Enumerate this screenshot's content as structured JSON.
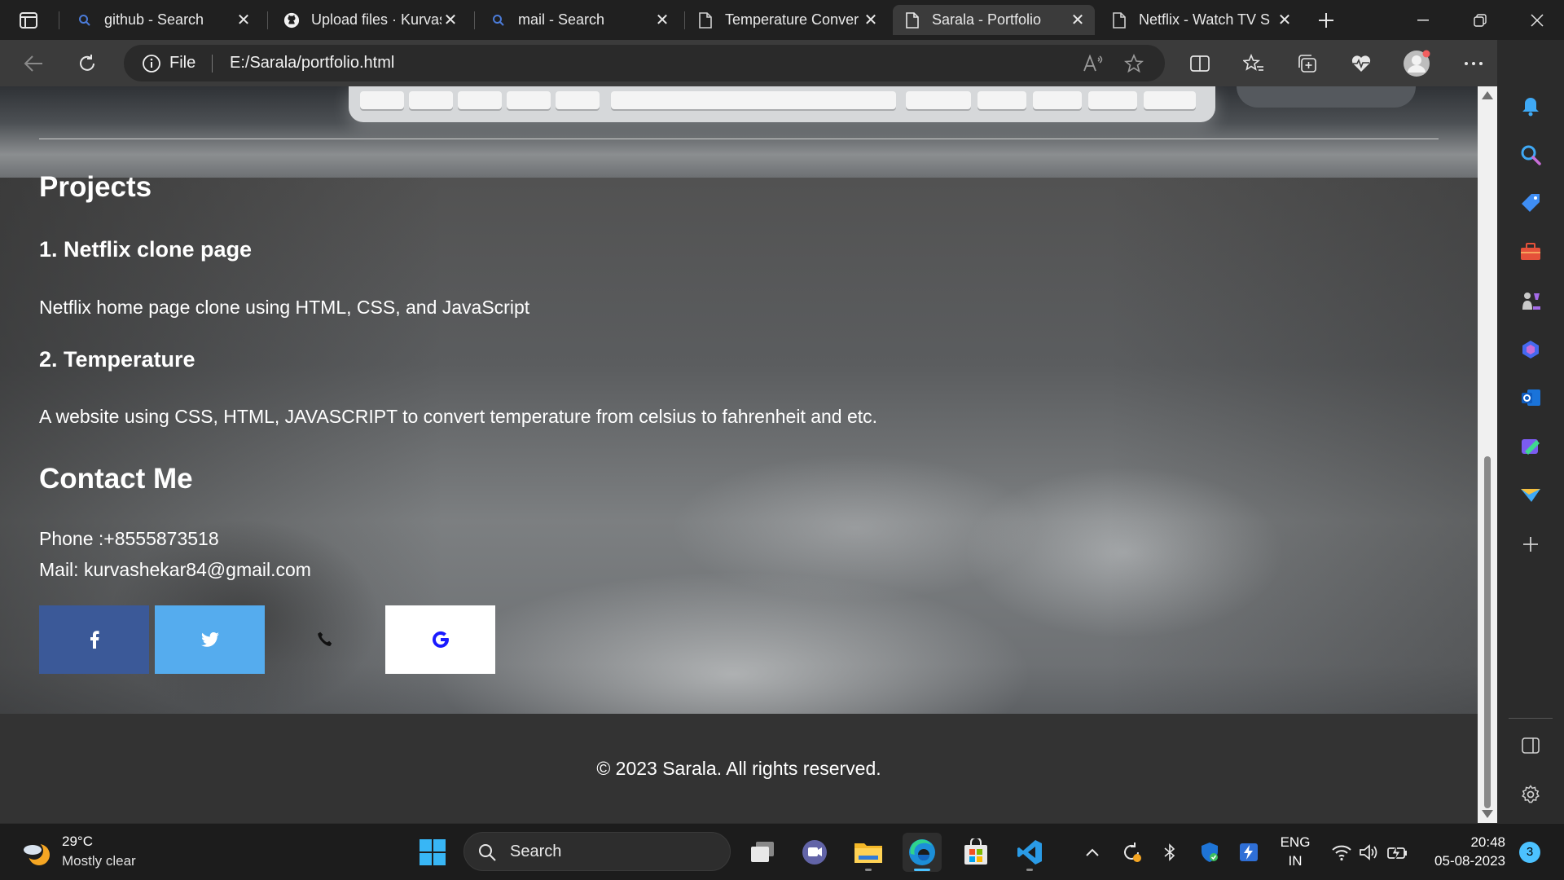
{
  "browser": {
    "tabs": [
      {
        "title": "github - Search",
        "icon": "search-icon"
      },
      {
        "title": "Upload files · Kurvas",
        "icon": "github-icon"
      },
      {
        "title": "mail - Search",
        "icon": "search-icon"
      },
      {
        "title": "Temperature Conver",
        "icon": "document-icon"
      },
      {
        "title": "Sarala - Portfolio",
        "icon": "document-icon",
        "active": true
      },
      {
        "title": "Netflix - Watch TV S",
        "icon": "document-icon"
      }
    ],
    "address": {
      "scheme_label": "File",
      "url": "E:/Sarala/portfolio.html"
    }
  },
  "page": {
    "projects_heading": "Projects",
    "projects": [
      {
        "title": "1. Netflix clone page",
        "description": "Netflix home page clone using HTML, CSS, and JavaScript"
      },
      {
        "title": "2. Temperature",
        "description": "A website using CSS, HTML, JAVASCRIPT to convert temperature from celsius to fahrenheit and etc."
      }
    ],
    "contact_heading": "Contact Me",
    "phone": "Phone :+8555873518",
    "mail": "Mail: kurvashekar84@gmail.com",
    "social": [
      {
        "name": "facebook",
        "icon": "facebook-icon",
        "color": "#3b5998"
      },
      {
        "name": "twitter",
        "icon": "twitter-icon",
        "color": "#55acee"
      },
      {
        "name": "phone",
        "icon": "phone-icon"
      },
      {
        "name": "google",
        "icon": "google-icon",
        "color": "#ffffff"
      }
    ],
    "footer": "© 2023 Sarala. All rights reserved."
  },
  "taskbar": {
    "weather": {
      "temp": "29°C",
      "desc": "Mostly clear"
    },
    "search_label": "Search",
    "language": [
      "ENG",
      "IN"
    ],
    "time": "20:48",
    "date": "05-08-2023",
    "notifications": "3"
  },
  "colors": {
    "accent": "#4cc2ff",
    "facebook": "#3b5998",
    "twitter": "#55acee",
    "google_text": "#1a1aff"
  }
}
